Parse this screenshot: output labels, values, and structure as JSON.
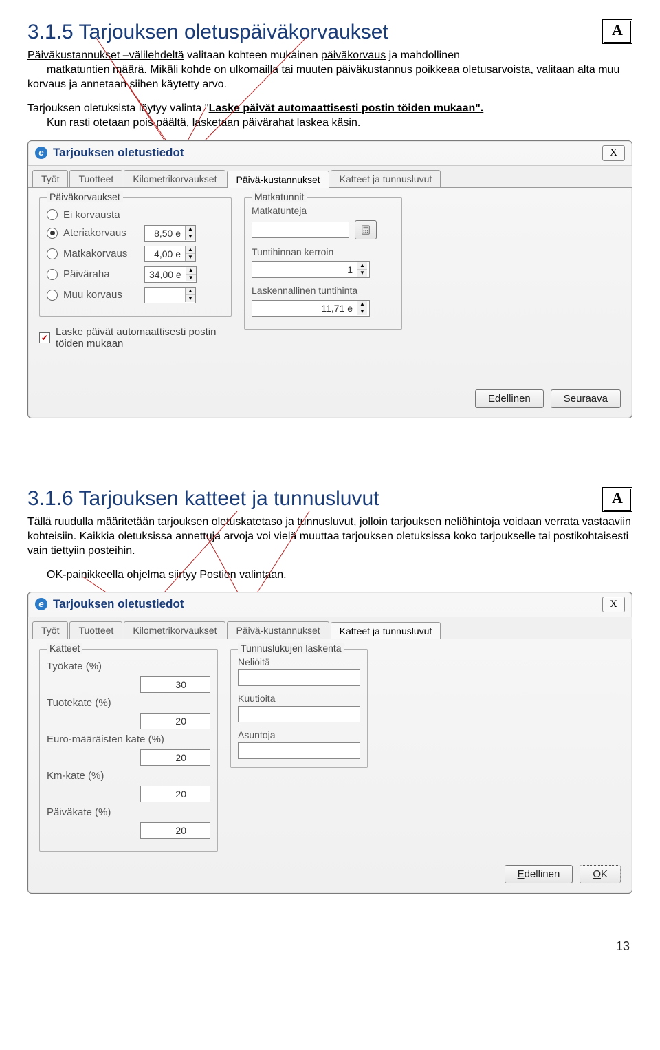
{
  "pageNumber": "13",
  "section1": {
    "heading_num": "3.1.5",
    "heading_text": "Tarjouksen oletuspäiväkorvaukset",
    "a_badge": "A",
    "p1_a": "Päiväkustannukset –välilehdeltä",
    "p1_b": " valitaan kohteen mukainen ",
    "p1_c": "päiväkorvaus",
    "p1_d": " ja mahdollinen ",
    "p1_e": "matkatuntien määrä",
    "p1_f": ". Mikäli kohde on ulkomailla tai muuten päiväkustannus poikkeaa oletusarvoista, valitaan alta muu korvaus ja annetaan siihen käytetty arvo.",
    "p2_a": "Tarjouksen oletuksista löytyy valinta \"",
    "p2_b": "Laske päivät automaattisesti postin töiden mukaan\".",
    "p2_c": "Kun rasti otetaan pois päältä, lasketaan päivärahat laskea käsin."
  },
  "dialog1": {
    "title": "Tarjouksen oletustiedot",
    "close": "X",
    "tabs": [
      "Työt",
      "Tuotteet",
      "Kilometrikorvaukset",
      "Päivä-kustannukset",
      "Katteet ja tunnusluvut"
    ],
    "activeTab": 3,
    "group_paivak": "Päiväkorvaukset",
    "radios": [
      {
        "label": "Ei korvausta",
        "val": ""
      },
      {
        "label": "Ateriakorvaus",
        "val": "8,50 e"
      },
      {
        "label": "Matkakorvaus",
        "val": "4,00 e"
      },
      {
        "label": "Päiväraha",
        "val": "34,00 e"
      },
      {
        "label": "Muu korvaus",
        "val": ""
      }
    ],
    "selectedRadio": 1,
    "auto_check_label": "Laske päivät automaattisesti postin töiden mukaan",
    "group_matkat": "Matkatunnit",
    "matkat_label": "Matkatunteja",
    "tuntih_label": "Tuntihinnan kerroin",
    "tuntih_val": "1",
    "lask_label": "Laskennallinen tuntihinta",
    "lask_val": "11,71 e",
    "btn_prev_u": "E",
    "btn_prev_rest": "dellinen",
    "btn_next_u": "S",
    "btn_next_rest": "euraava"
  },
  "section2": {
    "heading_num": "3.1.6",
    "heading_text": "Tarjouksen katteet ja tunnusluvut",
    "a_badge": "A",
    "p1_a": "Tällä ruudulla määritetään tarjouksen ",
    "p1_b": "oletuskatetaso",
    "p1_c": " ja ",
    "p1_d": "tunnusluvut",
    "p1_e": ", jolloin tarjouksen neliöhintoja voidaan verrata vastaaviin kohteisiin. Kaikkia oletuksissa annettuja arvoja voi vielä muuttaa tarjouksen oletuksissa koko tarjoukselle tai postikohtaisesti vain tiettyiin posteihin.",
    "p2_a": "OK-painikkeella",
    "p2_b": " ohjelma siirtyy Postien valintaan."
  },
  "dialog2": {
    "title": "Tarjouksen oletustiedot",
    "close": "X",
    "tabs": [
      "Työt",
      "Tuotteet",
      "Kilometrikorvaukset",
      "Päivä-kustannukset",
      "Katteet ja tunnusluvut"
    ],
    "activeTab": 4,
    "group_katteet": "Katteet",
    "katteet": [
      {
        "label": "Työkate (%)",
        "val": "30"
      },
      {
        "label": "Tuotekate (%)",
        "val": "20"
      },
      {
        "label": "Euro-määräisten kate (%)",
        "val": "20"
      },
      {
        "label": "Km-kate (%)",
        "val": "20"
      },
      {
        "label": "Päiväkate (%)",
        "val": "20"
      }
    ],
    "group_tunn": "Tunnuslukujen laskenta",
    "tunn": [
      "Neliöitä",
      "Kuutioita",
      "Asuntoja"
    ],
    "btn_prev_u": "E",
    "btn_prev_rest": "dellinen",
    "btn_ok_u": "O",
    "btn_ok_rest": "K"
  },
  "chart_data": {
    "type": "table",
    "dialog1_radios": [
      {
        "option": "Ei korvausta",
        "value": null,
        "selected": false
      },
      {
        "option": "Ateriakorvaus",
        "value": "8,50 e",
        "selected": true
      },
      {
        "option": "Matkakorvaus",
        "value": "4,00 e",
        "selected": false
      },
      {
        "option": "Päiväraha",
        "value": "34,00 e",
        "selected": false
      },
      {
        "option": "Muu korvaus",
        "value": null,
        "selected": false
      }
    ],
    "dialog1_values": {
      "Tuntihinnan kerroin": 1,
      "Laskennallinen tuntihinta": "11,71 e"
    },
    "dialog2_katteet": {
      "Työkate (%)": 30,
      "Tuotekate (%)": 20,
      "Euro-määräisten kate (%)": 20,
      "Km-kate (%)": 20,
      "Päiväkate (%)": 20
    }
  }
}
